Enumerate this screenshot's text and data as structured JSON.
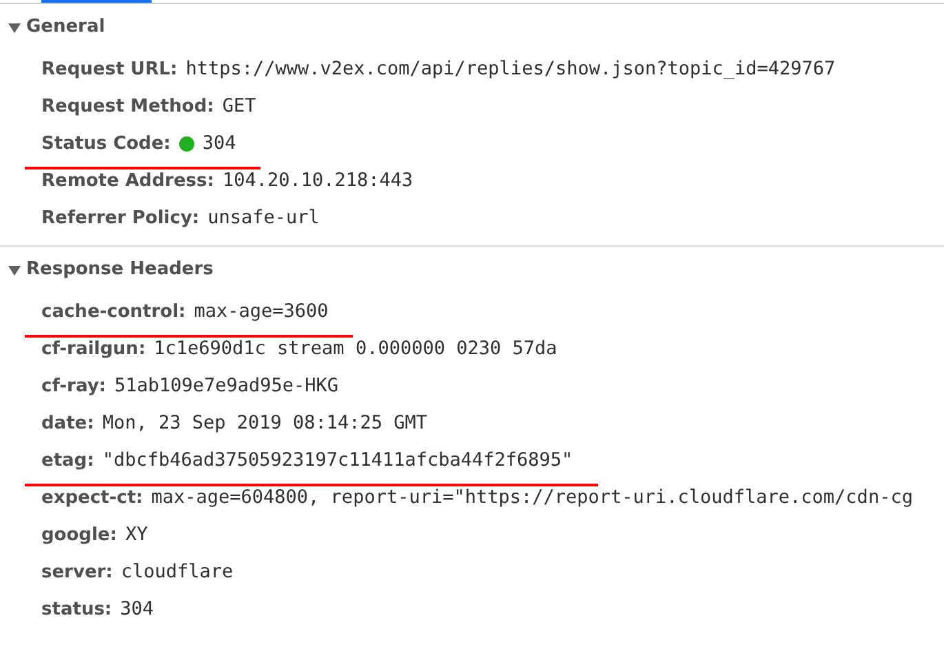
{
  "sections": [
    {
      "title": "General",
      "expanded": true,
      "rows": [
        {
          "name": "Request URL:",
          "value": "https://www.v2ex.com/api/replies/show.json?topic_id=429767",
          "underlined": false
        },
        {
          "name": "Request Method:",
          "value": "GET",
          "underlined": false
        },
        {
          "name": "Status Code:",
          "value": "304",
          "underlined": true,
          "color": "#22b022"
        },
        {
          "name": "Remote Address:",
          "value": "104.20.10.218:443",
          "underlined": false
        },
        {
          "name": "Referrer Policy:",
          "value": "unsafe-url",
          "underlined": false
        }
      ]
    },
    {
      "title": "Response Headers",
      "expanded": true,
      "rows": [
        {
          "name": "cache-control:",
          "value": "max-age=3600",
          "underlined": true
        },
        {
          "name": "cf-railgun:",
          "value": "1c1e690d1c stream 0.000000 0230 57da",
          "underlined": false
        },
        {
          "name": "cf-ray:",
          "value": "51ab109e7e9ad95e-HKG",
          "underlined": false
        },
        {
          "name": "date:",
          "value": "Mon, 23 Sep 2019 08:14:25 GMT",
          "underlined": false
        },
        {
          "name": "etag:",
          "value": "\"dbcfb46ad37505923197c11411afcba44f2f6895\"",
          "underlined": true
        },
        {
          "name": "expect-ct:",
          "value": "max-age=604800, report-uri=\"https://report-uri.cloudflare.com/cdn-cg",
          "underlined": false
        },
        {
          "name": "google:",
          "value": "XY",
          "underlined": false
        },
        {
          "name": "server:",
          "value": "cloudflare",
          "underlined": false
        },
        {
          "name": "status:",
          "value": "304",
          "underlined": false
        }
      ]
    }
  ]
}
